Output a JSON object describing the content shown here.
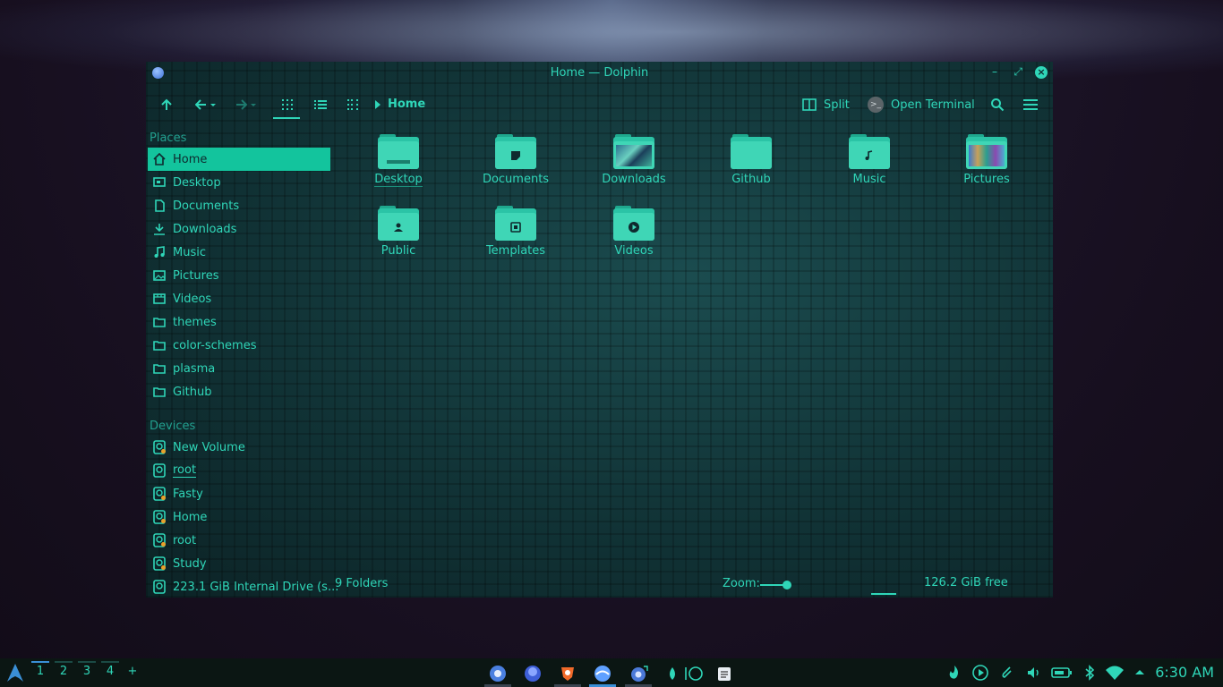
{
  "window": {
    "title": "Home — Dolphin",
    "minimize": "–",
    "maximize": "⤢",
    "close": "×"
  },
  "toolbar": {
    "breadcrumb": "Home",
    "split_label": "Split",
    "terminal_label": "Open Terminal"
  },
  "sidebar": {
    "places_title": "Places",
    "places": [
      {
        "label": "Home",
        "icon": "home-icon"
      },
      {
        "label": "Desktop",
        "icon": "desktop-icon"
      },
      {
        "label": "Documents",
        "icon": "document-icon"
      },
      {
        "label": "Downloads",
        "icon": "download-icon"
      },
      {
        "label": "Music",
        "icon": "music-icon"
      },
      {
        "label": "Pictures",
        "icon": "picture-icon"
      },
      {
        "label": "Videos",
        "icon": "video-icon"
      },
      {
        "label": "themes",
        "icon": "folder-icon"
      },
      {
        "label": "color-schemes",
        "icon": "folder-icon"
      },
      {
        "label": "plasma",
        "icon": "folder-icon"
      },
      {
        "label": "Github",
        "icon": "folder-icon"
      }
    ],
    "devices_title": "Devices",
    "devices": [
      {
        "label": "New Volume"
      },
      {
        "label": "root"
      },
      {
        "label": "Fasty"
      },
      {
        "label": "Home"
      },
      {
        "label": "root"
      },
      {
        "label": "Study"
      },
      {
        "label": "223.1 GiB Internal Drive (s..."
      }
    ]
  },
  "content": {
    "folders": [
      {
        "name": "Desktop",
        "icon": "desktop-folder-icon"
      },
      {
        "name": "Documents",
        "icon": "documents-folder-icon"
      },
      {
        "name": "Downloads",
        "icon": "downloads-folder-icon"
      },
      {
        "name": "Github",
        "icon": "folder-icon"
      },
      {
        "name": "Music",
        "icon": "music-folder-icon"
      },
      {
        "name": "Pictures",
        "icon": "pictures-folder-icon"
      },
      {
        "name": "Public",
        "icon": "public-folder-icon"
      },
      {
        "name": "Templates",
        "icon": "templates-folder-icon"
      },
      {
        "name": "Videos",
        "icon": "videos-folder-icon"
      }
    ]
  },
  "status": {
    "count": "9 Folders",
    "zoom_label": "Zoom:",
    "free": "126.2 GiB free"
  },
  "taskbar": {
    "desktops": [
      "1",
      "2",
      "3",
      "4"
    ],
    "add": "+",
    "clock": "6:30 AM"
  },
  "colors": {
    "accent": "#2fd6b8",
    "selection": "#13c49d",
    "window_bg": "#0f2a2e"
  }
}
